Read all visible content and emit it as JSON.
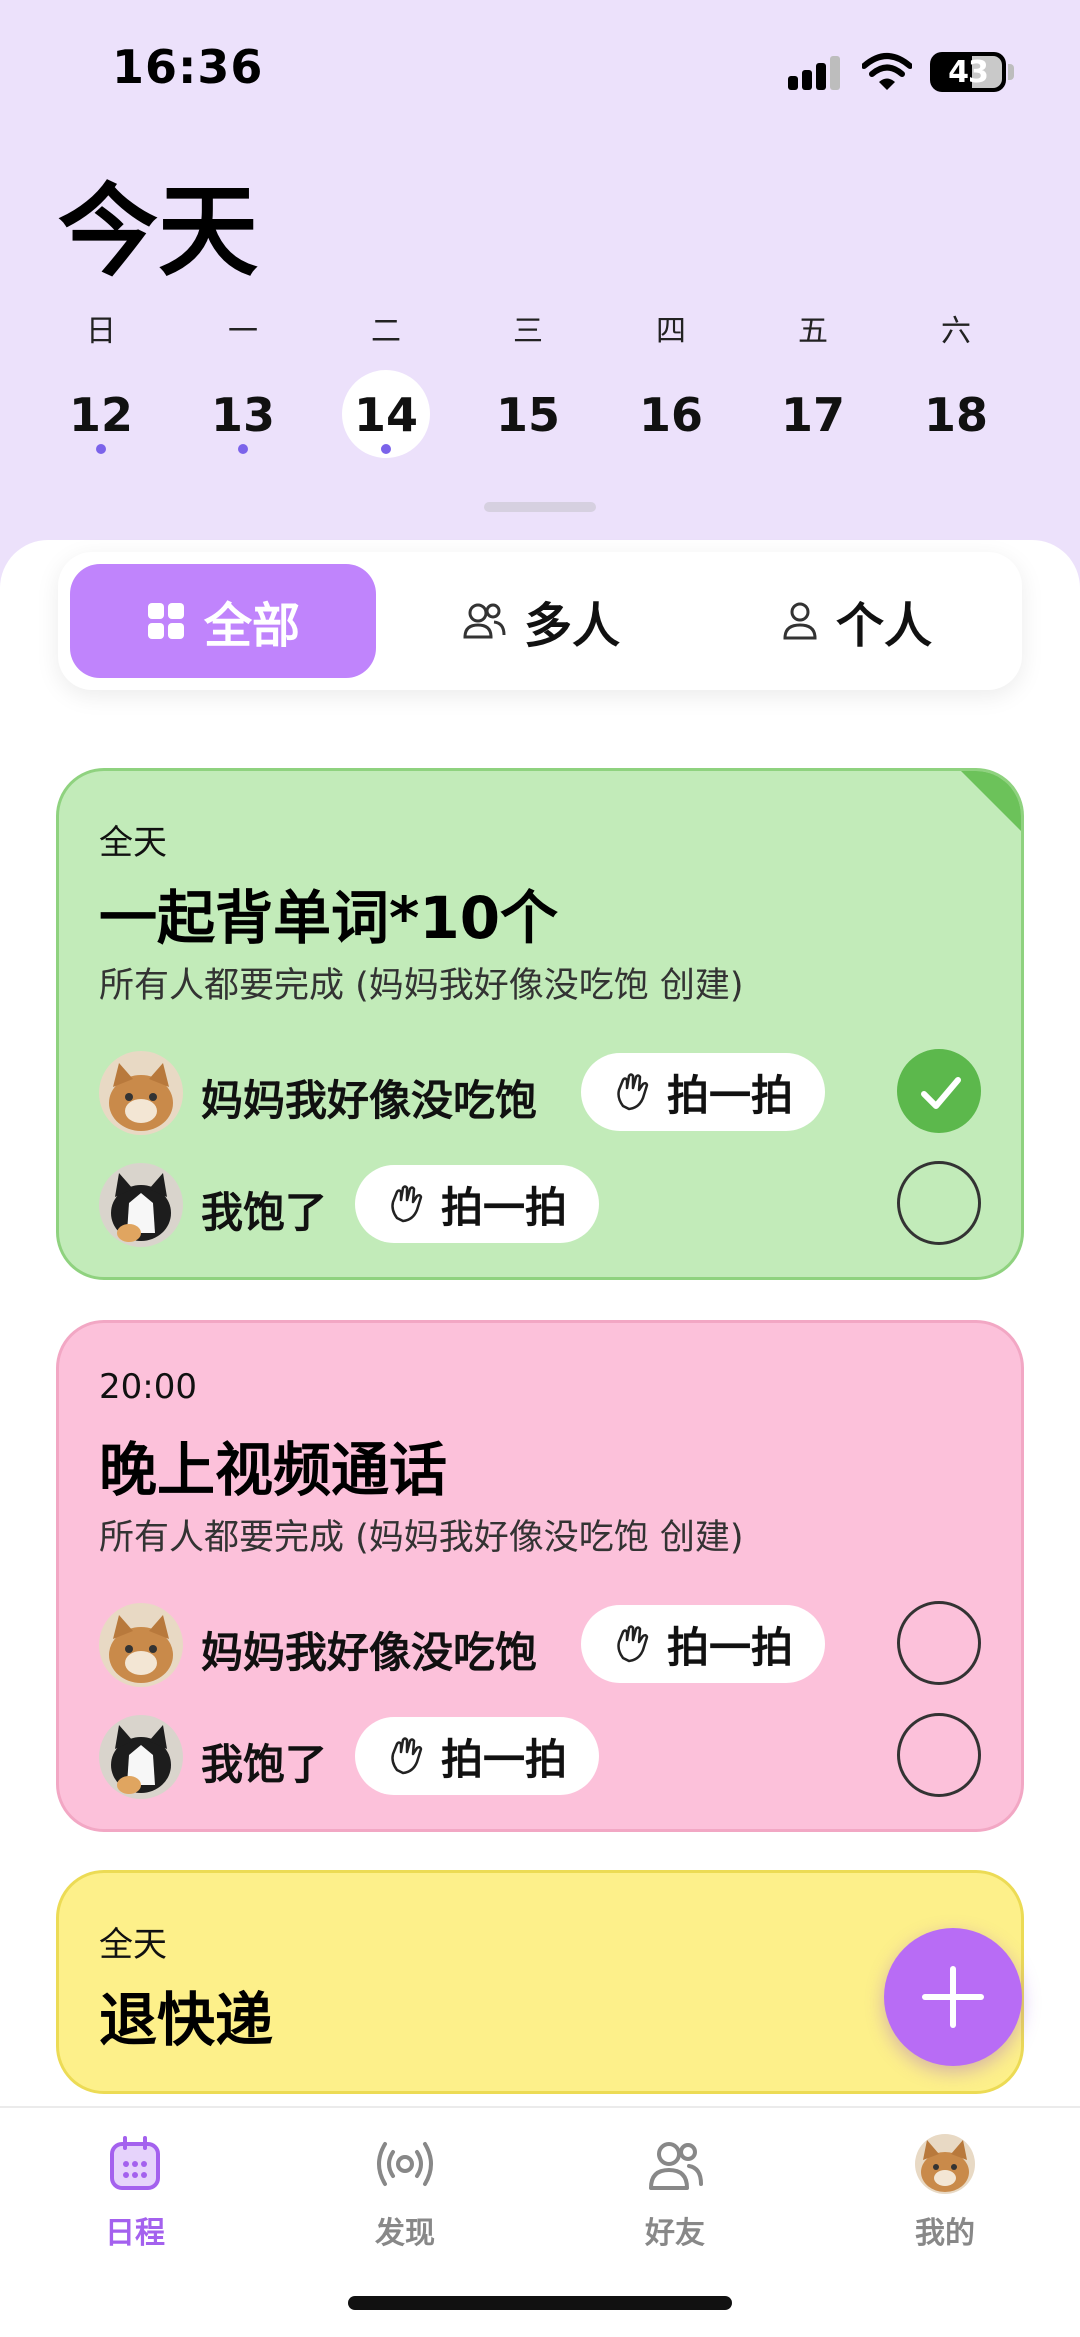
{
  "status": {
    "time": "16:36",
    "battery": "43"
  },
  "page_title": "今天",
  "week": [
    {
      "dow": "日",
      "date": "12",
      "dot": true,
      "selected": false
    },
    {
      "dow": "一",
      "date": "13",
      "dot": true,
      "selected": false
    },
    {
      "dow": "二",
      "date": "14",
      "dot": true,
      "selected": true
    },
    {
      "dow": "三",
      "date": "15",
      "dot": false,
      "selected": false
    },
    {
      "dow": "四",
      "date": "16",
      "dot": false,
      "selected": false
    },
    {
      "dow": "五",
      "date": "17",
      "dot": false,
      "selected": false
    },
    {
      "dow": "六",
      "date": "18",
      "dot": false,
      "selected": false
    }
  ],
  "segments": [
    {
      "label": "全部",
      "icon": "grid-icon",
      "active": true
    },
    {
      "label": "多人",
      "icon": "people-icon",
      "active": false
    },
    {
      "label": "个人",
      "icon": "person-icon",
      "active": false
    }
  ],
  "tasks": [
    {
      "time": "全天",
      "title": "一起背单词*10个",
      "subtitle": "所有人都要完成 (妈妈我好像没吃饱 创建)",
      "color": "#c2ebb9",
      "members": [
        {
          "name": "妈妈我好像没吃饱",
          "pat_label": "拍一拍",
          "done": true,
          "avatar": "tabby-cat-avatar"
        },
        {
          "name": "我饱了",
          "pat_label": "拍一拍",
          "done": false,
          "avatar": "tuxedo-cat-avatar"
        }
      ]
    },
    {
      "time": "20:00",
      "title": "晚上视频通话",
      "subtitle": "所有人都要完成 (妈妈我好像没吃饱 创建)",
      "color": "#fcc1da",
      "members": [
        {
          "name": "妈妈我好像没吃饱",
          "pat_label": "拍一拍",
          "done": false,
          "avatar": "tabby-cat-avatar"
        },
        {
          "name": "我饱了",
          "pat_label": "拍一拍",
          "done": false,
          "avatar": "tuxedo-cat-avatar"
        }
      ]
    },
    {
      "time": "全天",
      "title": "退快递",
      "color": "#fdf08a"
    }
  ],
  "tabbar": [
    {
      "label": "日程",
      "icon": "calendar-icon",
      "active": true
    },
    {
      "label": "发现",
      "icon": "broadcast-icon",
      "active": false
    },
    {
      "label": "好友",
      "icon": "friends-icon",
      "active": false
    },
    {
      "label": "我的",
      "icon": "profile-avatar",
      "active": false
    }
  ],
  "colors": {
    "accent": "#c084fc",
    "header_bg": "#ece1fb",
    "check_done": "#5cb84c",
    "tab_active": "#a461ee"
  }
}
